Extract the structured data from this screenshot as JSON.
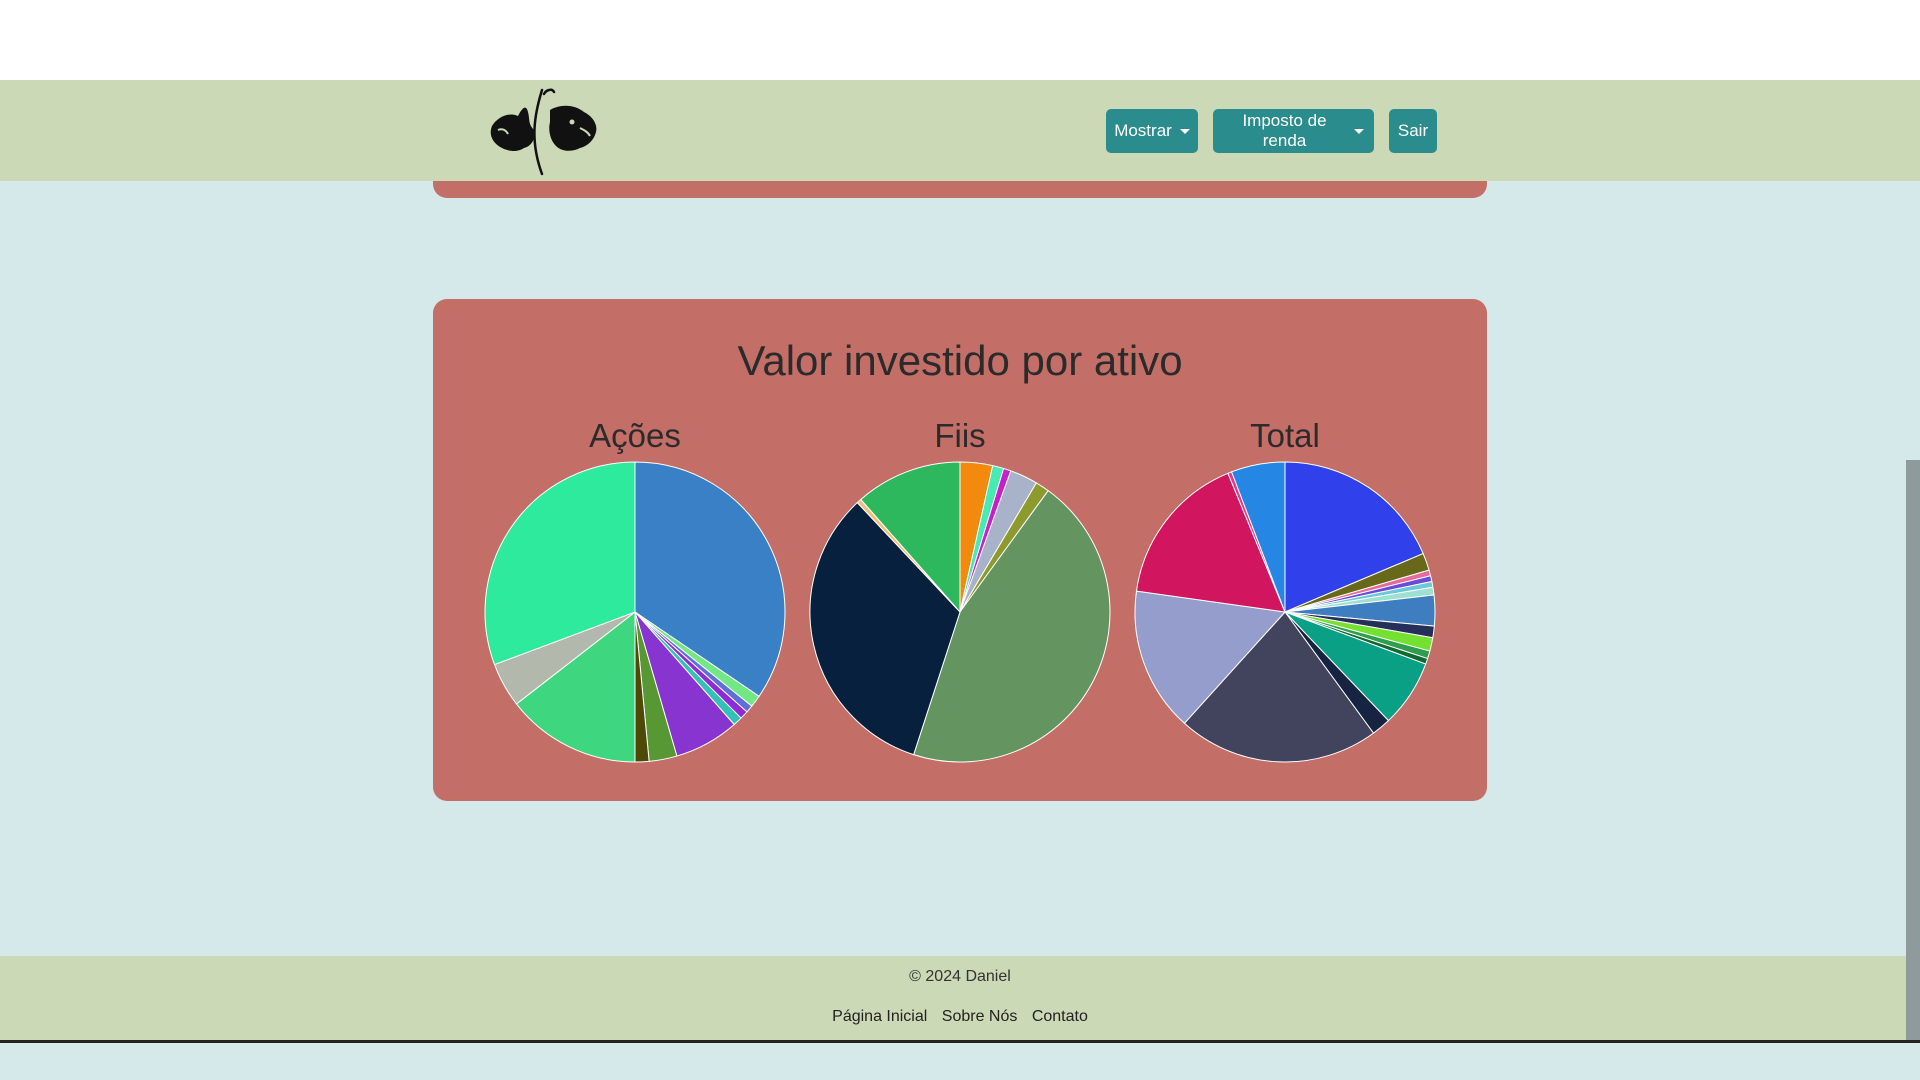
{
  "navbar": {
    "buttons": [
      {
        "label": "Mostrar",
        "dropdown": true
      },
      {
        "label": "Imposto de renda",
        "dropdown": true
      },
      {
        "label": "Sair",
        "dropdown": false
      }
    ],
    "color": "#2a8c8c"
  },
  "panel": {
    "title": "Valor investido por ativo"
  },
  "chart_data": [
    {
      "type": "pie",
      "title": "Ações",
      "slices": [
        {
          "value": 34.5,
          "color": "#3a80c6"
        },
        {
          "value": 1.3,
          "color": "#72e884"
        },
        {
          "value": 0.8,
          "color": "#5e6fd8"
        },
        {
          "value": 0.9,
          "color": "#8e2bd6"
        },
        {
          "value": 1.0,
          "color": "#32c0b7"
        },
        {
          "value": 7.0,
          "color": "#8834d0"
        },
        {
          "value": 3.0,
          "color": "#579834"
        },
        {
          "value": 1.5,
          "color": "#4d4a08"
        },
        {
          "value": 14.5,
          "color": "#3ed67e"
        },
        {
          "value": 4.8,
          "color": "#b2b8ac"
        },
        {
          "value": 30.7,
          "color": "#2eea9c"
        }
      ]
    },
    {
      "type": "pie",
      "title": "Fiis",
      "slices": [
        {
          "value": 3.5,
          "color": "#f28a0e"
        },
        {
          "value": 1.2,
          "color": "#48eab4"
        },
        {
          "value": 0.8,
          "color": "#c720c8"
        },
        {
          "value": 3.0,
          "color": "#a8b2c8"
        },
        {
          "value": 1.5,
          "color": "#8d9a2e"
        },
        {
          "value": 45.0,
          "color": "#649460"
        },
        {
          "value": 33.0,
          "color": "#06203e"
        },
        {
          "value": 0.5,
          "color": "#f0c17a"
        },
        {
          "value": 11.5,
          "color": "#2eb85e"
        }
      ]
    },
    {
      "type": "pie",
      "title": "Total",
      "slices": [
        {
          "value": 18.0,
          "color": "#3040ea"
        },
        {
          "value": 1.8,
          "color": "#68681a"
        },
        {
          "value": 0.6,
          "color": "#e86a9a"
        },
        {
          "value": 0.6,
          "color": "#6a4ad8"
        },
        {
          "value": 0.6,
          "color": "#6ac8d8"
        },
        {
          "value": 0.8,
          "color": "#9ee0d0"
        },
        {
          "value": 3.2,
          "color": "#3e7ec0"
        },
        {
          "value": 1.2,
          "color": "#24305a"
        },
        {
          "value": 1.4,
          "color": "#74e030"
        },
        {
          "value": 0.8,
          "color": "#2e9e4e"
        },
        {
          "value": 0.6,
          "color": "#106b2e"
        },
        {
          "value": 7.0,
          "color": "#0aa085"
        },
        {
          "value": 2.0,
          "color": "#162442"
        },
        {
          "value": 21.0,
          "color": "#42445e"
        },
        {
          "value": 15.0,
          "color": "#949dcb"
        },
        {
          "value": 16.0,
          "color": "#d1155e"
        },
        {
          "value": 0.4,
          "color": "#e23a8a"
        },
        {
          "value": 5.6,
          "color": "#2686e4"
        }
      ]
    }
  ],
  "footer": {
    "copyright": "© 2024 Daniel",
    "links": [
      "Página Inicial",
      "Sobre Nós",
      "Contato"
    ]
  }
}
